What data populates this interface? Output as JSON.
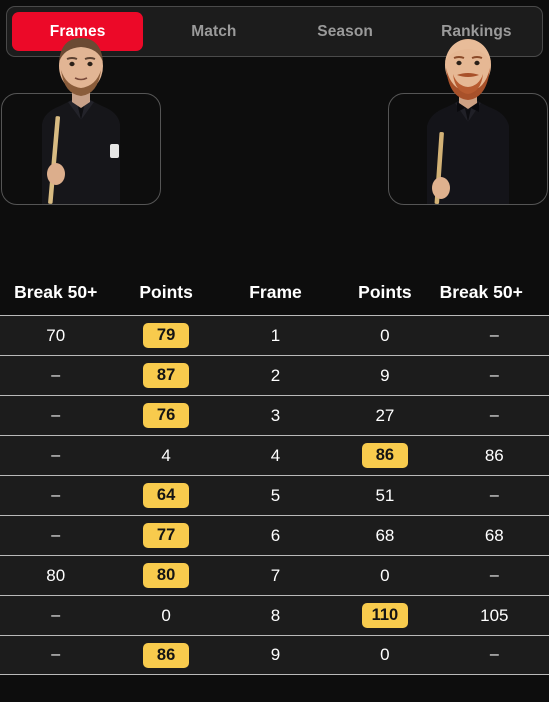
{
  "tabs": [
    {
      "label": "Frames",
      "active": true
    },
    {
      "label": "Match",
      "active": false
    },
    {
      "label": "Season",
      "active": false
    },
    {
      "label": "Rankings",
      "active": false
    }
  ],
  "colors": {
    "accent_red": "#ec0928",
    "badge_yellow": "#f8cb4d",
    "row_bg": "#1c1c1c",
    "page_bg": "#0d0d0d",
    "divider": "#b9b9b9"
  },
  "players": {
    "left": {
      "icon": "player-portrait-left"
    },
    "right": {
      "icon": "player-portrait-right"
    }
  },
  "table": {
    "headers": [
      "Break 50+",
      "Points",
      "Frame",
      "Points",
      "Break 50+"
    ],
    "rows": [
      {
        "break_left": "70",
        "points_left": "79",
        "points_left_win": true,
        "frame": "1",
        "points_right": "0",
        "points_right_win": false,
        "break_right": "–"
      },
      {
        "break_left": "–",
        "points_left": "87",
        "points_left_win": true,
        "frame": "2",
        "points_right": "9",
        "points_right_win": false,
        "break_right": "–"
      },
      {
        "break_left": "–",
        "points_left": "76",
        "points_left_win": true,
        "frame": "3",
        "points_right": "27",
        "points_right_win": false,
        "break_right": "–"
      },
      {
        "break_left": "–",
        "points_left": "4",
        "points_left_win": false,
        "frame": "4",
        "points_right": "86",
        "points_right_win": true,
        "break_right": "86"
      },
      {
        "break_left": "–",
        "points_left": "64",
        "points_left_win": true,
        "frame": "5",
        "points_right": "51",
        "points_right_win": false,
        "break_right": "–"
      },
      {
        "break_left": "–",
        "points_left": "77",
        "points_left_win": true,
        "frame": "6",
        "points_right": "68",
        "points_right_win": false,
        "break_right": "68"
      },
      {
        "break_left": "80",
        "points_left": "80",
        "points_left_win": true,
        "frame": "7",
        "points_right": "0",
        "points_right_win": false,
        "break_right": "–"
      },
      {
        "break_left": "–",
        "points_left": "0",
        "points_left_win": false,
        "frame": "8",
        "points_right": "110",
        "points_right_win": true,
        "break_right": "105"
      },
      {
        "break_left": "–",
        "points_left": "86",
        "points_left_win": true,
        "frame": "9",
        "points_right": "0",
        "points_right_win": false,
        "break_right": "–"
      }
    ]
  }
}
